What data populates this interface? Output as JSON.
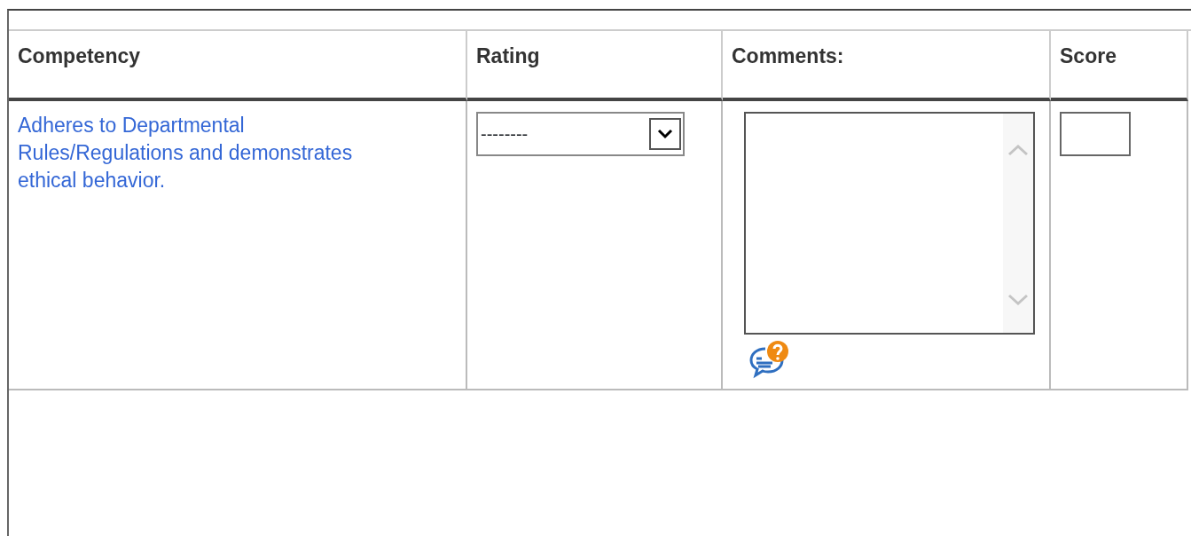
{
  "table": {
    "columns": [
      "Competency",
      "Rating",
      "Comments:",
      "Score"
    ],
    "rows": [
      {
        "competency": "Adheres to Departmental Rules/Regulations and demonstrates ethical behavior.",
        "rating": "--------"
      }
    ]
  }
}
